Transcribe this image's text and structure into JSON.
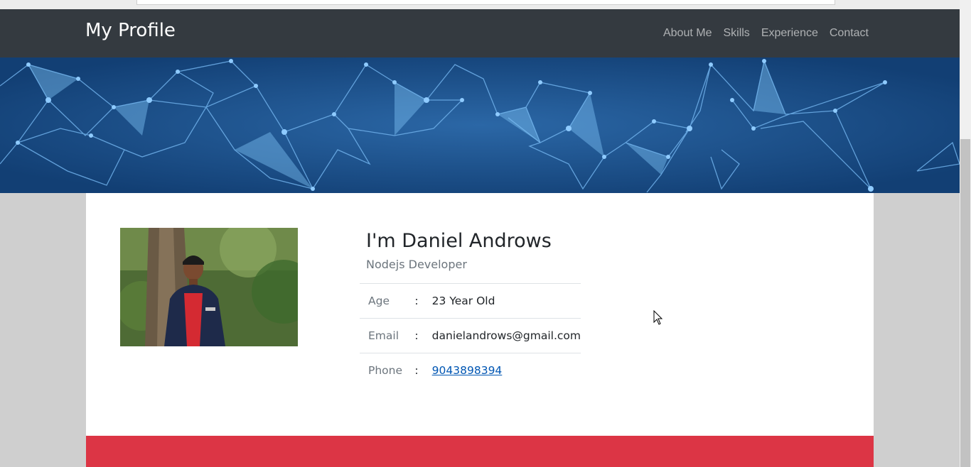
{
  "navbar": {
    "brand": "My Profile",
    "links": [
      "About Me",
      "Skills",
      "Experience",
      "Contact"
    ]
  },
  "profile": {
    "name": "I'm Daniel Androws",
    "role": "Nodejs Developer",
    "photo_alt": "profile-photo",
    "details": [
      {
        "label": "Age",
        "sep": ":",
        "value": "23 Year Old"
      },
      {
        "label": "Email",
        "sep": ":",
        "value": "danielandrows@gmail.com"
      },
      {
        "label": "Phone",
        "sep": ":",
        "value": "9043898394"
      }
    ]
  },
  "colors": {
    "navbar_bg": "#343a40",
    "hero_bg": "#184c86",
    "accent_red": "#dc3545",
    "link_blue": "#0056b3"
  }
}
